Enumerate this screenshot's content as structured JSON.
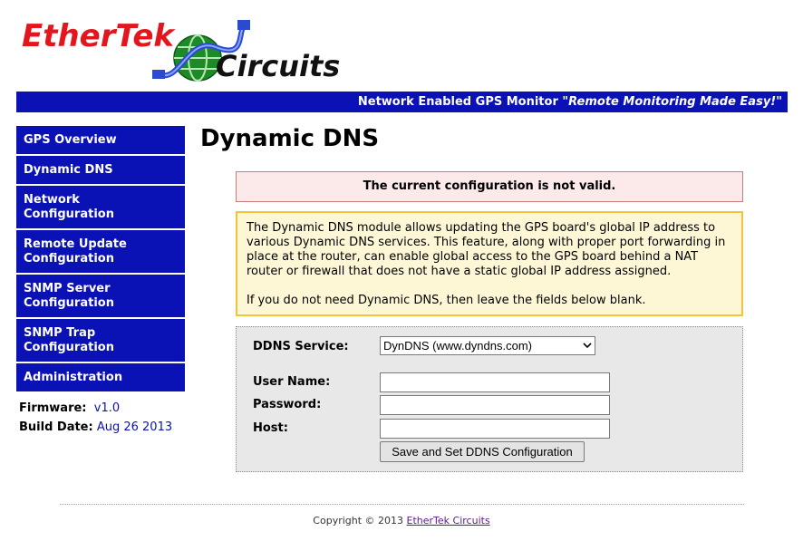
{
  "logo": {
    "word1": "EtherTek",
    "word2": "Circuits"
  },
  "banner": {
    "product": "Network Enabled GPS Monitor ",
    "slogan": "\"Remote Monitoring Made Easy!\""
  },
  "sidebar": {
    "items": [
      {
        "line1": "GPS Overview"
      },
      {
        "line1": "Dynamic DNS"
      },
      {
        "line1": "Network",
        "line2": "Configuration"
      },
      {
        "line1": "Remote Update",
        "line2": "Configuration"
      },
      {
        "line1": "SNMP Server",
        "line2": "Configuration"
      },
      {
        "line1": "SNMP Trap",
        "line2": "Configuration"
      },
      {
        "line1": "Administration"
      }
    ],
    "firmware_label": "Firmware:",
    "firmware_value": "v1.0",
    "build_label": "Build Date:",
    "build_value": "Aug 26 2013"
  },
  "page": {
    "title": "Dynamic DNS"
  },
  "alert": {
    "text": "The current configuration is not valid."
  },
  "info": {
    "para1": "The Dynamic DNS module allows updating the GPS board's global IP address to various Dynamic DNS services. This feature, along with proper port forwarding in place at the router, can enable global access to the GPS board behind a NAT router or firewall that does not have a static global IP address assigned.",
    "para2": "If you do not need Dynamic DNS, then leave the fields below blank."
  },
  "form": {
    "service_label": "DDNS Service:",
    "service_value": "DynDNS (www.dyndns.com)",
    "username_label": "User Name:",
    "username_value": "",
    "password_label": "Password:",
    "password_value": "",
    "host_label": "Host:",
    "host_value": "",
    "submit_label": "Save and Set DDNS Configuration"
  },
  "footer": {
    "copyright": "Copyright © 2013 ",
    "link": "EtherTek Circuits"
  },
  "colors": {
    "nav_blue": "#0a12b5",
    "brand_red": "#e4161d",
    "alert_bg": "#fce9e9",
    "info_bg": "#fef7d5",
    "info_border": "#f3c33c"
  },
  "icons": {
    "logo_graphic": "globe-cable-icon",
    "select_arrow": "chevron-down-icon"
  }
}
